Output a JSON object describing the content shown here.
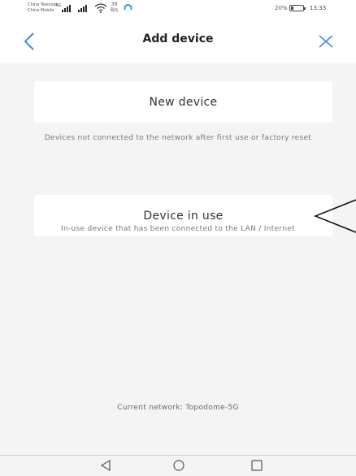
{
  "status_bar": {
    "carrier_1": "China Telecom",
    "carrier_2": "China Mobile",
    "net_type": "4G",
    "speed_value": "39",
    "speed_unit": "B/s",
    "battery": "20%",
    "time": "13:33"
  },
  "header": {
    "title": "Add device",
    "back_icon": "chevron-left-icon",
    "close_icon": "close-icon",
    "accent_color": "#3a8ee6"
  },
  "options": {
    "new_device": {
      "label": "New device",
      "description": "Devices not connected to the network after first use or factory reset"
    },
    "device_in_use": {
      "label": "Device in use",
      "description": "In-use device that has been connected to the LAN / Internet"
    }
  },
  "current_network": "Current network: Topodome-5G",
  "nav_bar": {
    "back_icon": "triangle-back-icon",
    "home_icon": "circle-home-icon",
    "recent_icon": "square-recent-icon"
  }
}
